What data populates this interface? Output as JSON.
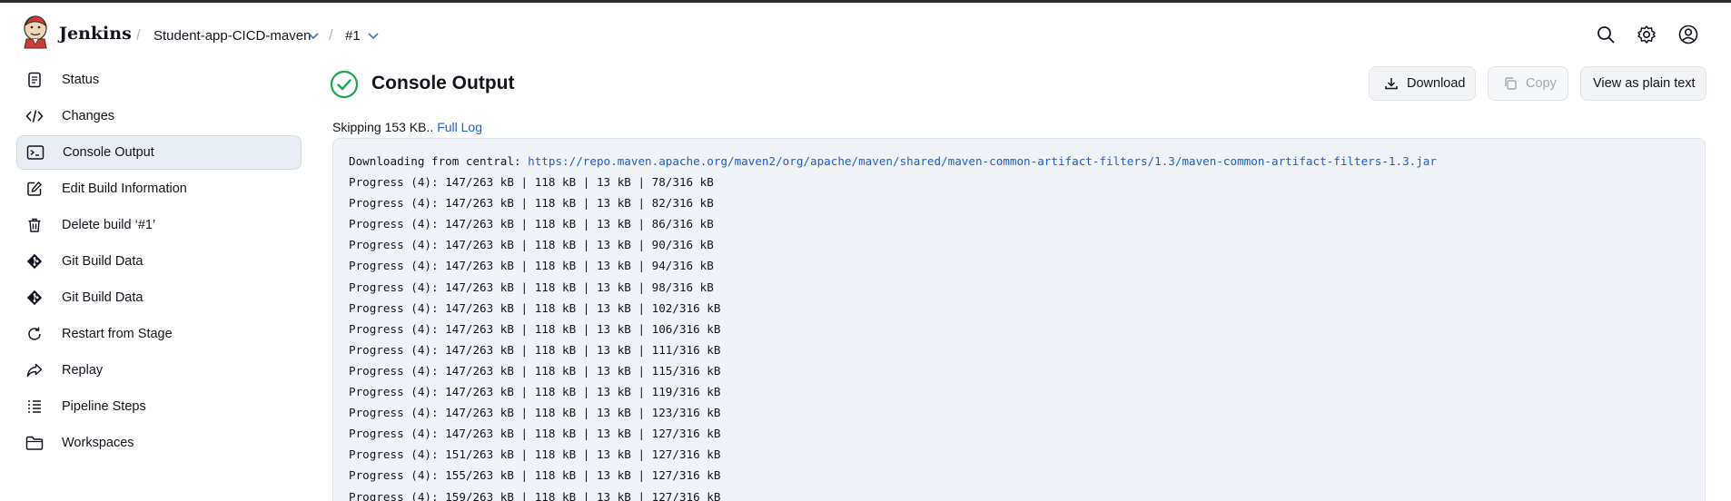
{
  "header": {
    "brand": "Jenkins",
    "breadcrumbs": [
      {
        "label": "Student-app-CICD-maven"
      },
      {
        "label": "#1"
      }
    ],
    "icons": [
      "search-icon",
      "gear-icon",
      "user-icon"
    ]
  },
  "sidebar": {
    "items": [
      {
        "label": "Status",
        "icon": "status-icon"
      },
      {
        "label": "Changes",
        "icon": "code-icon"
      },
      {
        "label": "Console Output",
        "icon": "terminal-icon",
        "active": true
      },
      {
        "label": "Edit Build Information",
        "icon": "edit-icon"
      },
      {
        "label": "Delete build ‘#1’",
        "icon": "trash-icon"
      },
      {
        "label": "Git Build Data",
        "icon": "git-icon"
      },
      {
        "label": "Git Build Data",
        "icon": "git-icon"
      },
      {
        "label": "Restart from Stage",
        "icon": "restart-icon"
      },
      {
        "label": "Replay",
        "icon": "replay-icon"
      },
      {
        "label": "Pipeline Steps",
        "icon": "steps-icon"
      },
      {
        "label": "Workspaces",
        "icon": "folder-icon"
      }
    ]
  },
  "main": {
    "title": "Console Output",
    "status_color": "#1ea64b",
    "buttons": {
      "download": "Download",
      "copy": "Copy",
      "plain_text": "View as plain text"
    },
    "skip_text": "Skipping 153 KB.. ",
    "full_log": "Full Log",
    "console": {
      "first_prefix": "Downloading from central: ",
      "first_link": "https://repo.maven.apache.org/maven2/org/apache/maven/shared/maven-common-artifact-filters/1.3/maven-common-artifact-filters-1.3.jar",
      "lines": [
        "Progress (4): 147/263 kB | 118 kB | 13 kB | 78/316 kB",
        "Progress (4): 147/263 kB | 118 kB | 13 kB | 82/316 kB",
        "Progress (4): 147/263 kB | 118 kB | 13 kB | 86/316 kB",
        "Progress (4): 147/263 kB | 118 kB | 13 kB | 90/316 kB",
        "Progress (4): 147/263 kB | 118 kB | 13 kB | 94/316 kB",
        "Progress (4): 147/263 kB | 118 kB | 13 kB | 98/316 kB",
        "Progress (4): 147/263 kB | 118 kB | 13 kB | 102/316 kB",
        "Progress (4): 147/263 kB | 118 kB | 13 kB | 106/316 kB",
        "Progress (4): 147/263 kB | 118 kB | 13 kB | 111/316 kB",
        "Progress (4): 147/263 kB | 118 kB | 13 kB | 115/316 kB",
        "Progress (4): 147/263 kB | 118 kB | 13 kB | 119/316 kB",
        "Progress (4): 147/263 kB | 118 kB | 13 kB | 123/316 kB",
        "Progress (4): 147/263 kB | 118 kB | 13 kB | 127/316 kB",
        "Progress (4): 151/263 kB | 118 kB | 13 kB | 127/316 kB",
        "Progress (4): 155/263 kB | 118 kB | 13 kB | 127/316 kB",
        "Progress (4): 159/263 kB | 118 kB | 13 kB | 127/316 kB"
      ]
    }
  }
}
